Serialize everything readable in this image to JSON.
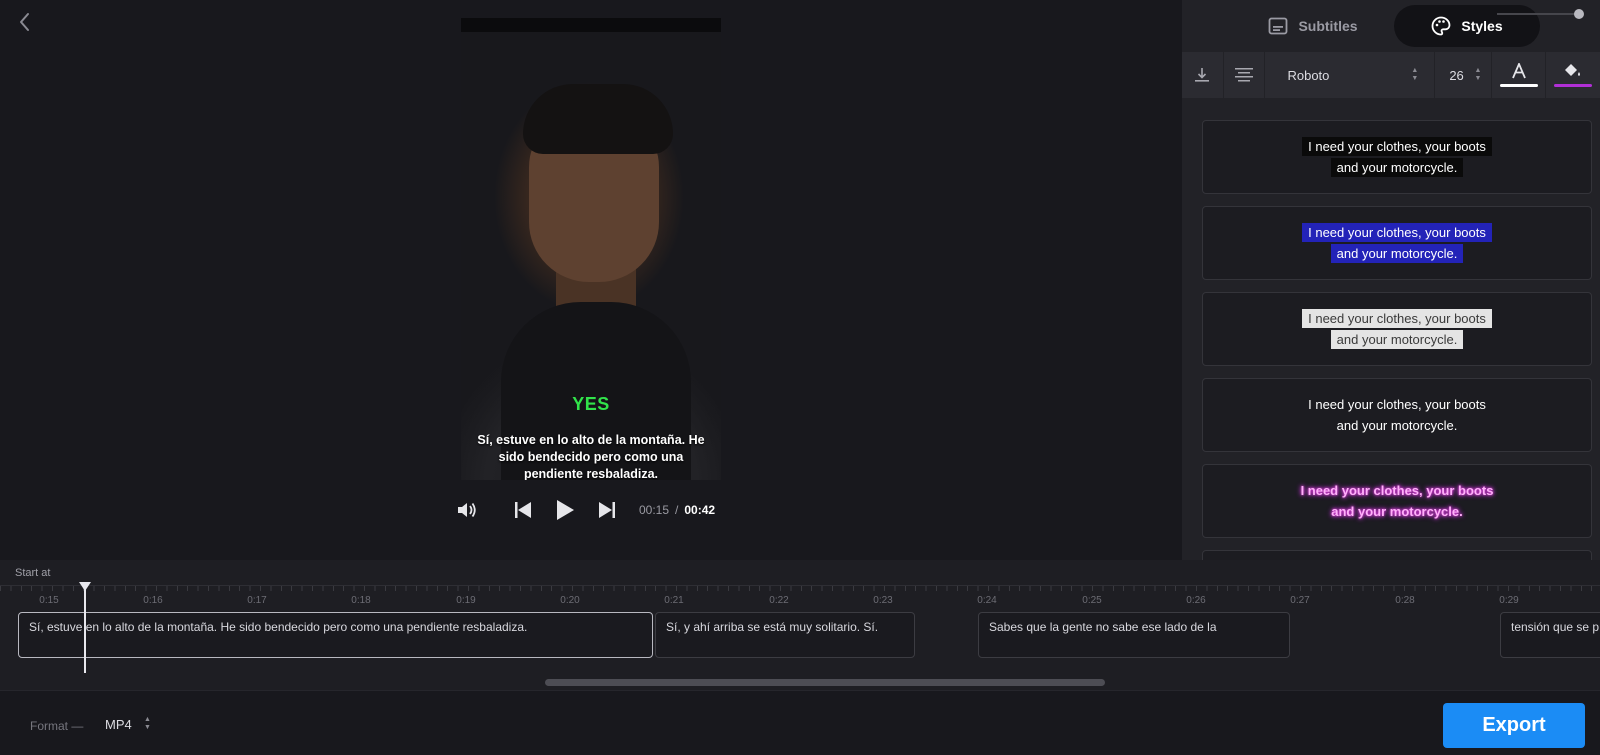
{
  "preview": {
    "caption_highlight": "YES",
    "caption_text": "Sí, estuve en lo alto de la montaña. He sido bendecido pero como una pendiente resbaladiza."
  },
  "player": {
    "current_time": "00:15",
    "separator": "/",
    "total_time": "00:42"
  },
  "panel": {
    "tabs": [
      {
        "label": "Subtitles",
        "icon": "subtitles-icon",
        "active": false
      },
      {
        "label": "Styles",
        "icon": "palette-icon",
        "active": true
      }
    ],
    "toolbar": {
      "font": "Roboto",
      "size": "26",
      "text_color": "#ffffff",
      "highlight_color": "#b12fd6"
    },
    "style_presets": [
      {
        "line1": "I need your clothes, your boots",
        "line2": "and your motorcycle.",
        "color": "#ffffff",
        "background": "#0a0a0a"
      },
      {
        "line1": "I need your clothes, your boots",
        "line2": "and your motorcycle.",
        "color": "#ffffff",
        "background": "#2323b8"
      },
      {
        "line1": "I need your clothes, your boots",
        "line2": "and your motorcycle.",
        "color": "#3a3a3a",
        "background": "#e4e4e4"
      },
      {
        "line1": "I need your clothes, your boots",
        "line2": "and your motorcycle.",
        "color": "#ffffff",
        "background": "transparent"
      },
      {
        "line1": "I need your clothes, your boots",
        "line2": "and your motorcycle.",
        "color": "#ff7df5",
        "background": "transparent",
        "glow": "#d23cd0"
      }
    ]
  },
  "timeline": {
    "start_label": "Start at",
    "ticks": [
      "0:15",
      "0:16",
      "0:17",
      "0:18",
      "0:19",
      "0:20",
      "0:21",
      "0:22",
      "0:23",
      "0:24",
      "0:25",
      "0:26",
      "0:27",
      "0:28",
      "0:29"
    ],
    "segments": [
      {
        "text": "Sí, estuve en lo alto de la montaña. He sido bendecido pero como una pendiente resbaladiza.",
        "active": true
      },
      {
        "text": "Sí, y ahí arriba se está muy solitario. Sí.",
        "active": false
      },
      {
        "text": "Sabes que la gente no sabe ese lado de la",
        "active": false
      },
      {
        "text": "tensión que se p",
        "active": false
      }
    ]
  },
  "footer": {
    "format_label": "Format —",
    "format_value": "MP4",
    "export_label": "Export"
  }
}
